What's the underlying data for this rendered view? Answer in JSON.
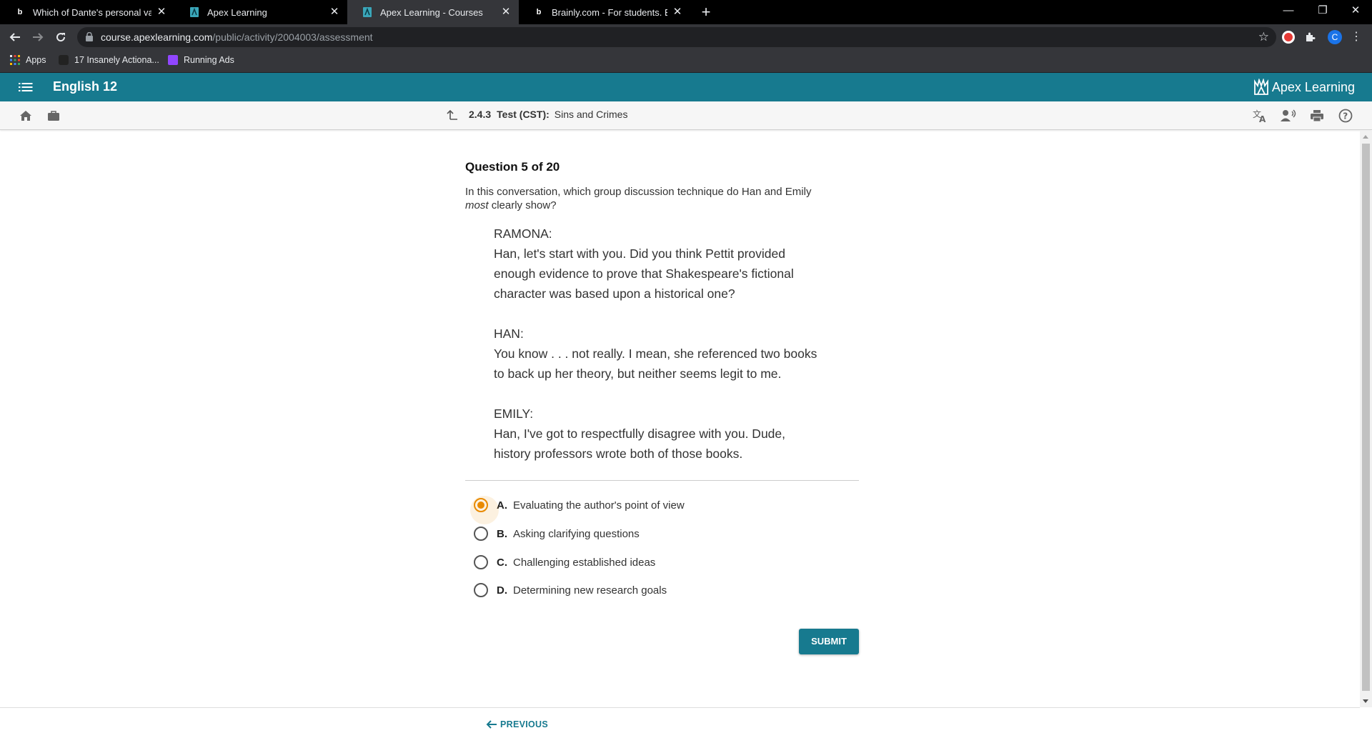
{
  "browser": {
    "tabs": [
      {
        "favicon": "brainly-icon",
        "title": "Which of Dante's personal values",
        "active": false
      },
      {
        "favicon": "apex-icon",
        "title": "Apex Learning",
        "active": false
      },
      {
        "favicon": "apex-icon",
        "title": "Apex Learning - Courses",
        "active": true
      },
      {
        "favicon": "brainly-icon",
        "title": "Brainly.com - For students. By students",
        "active": false
      }
    ],
    "url_host": "course.apexlearning.com",
    "url_path": "/public/activity/2004003/assessment",
    "profile_initial": "C",
    "bookmarks": [
      {
        "icon": "apps-grid-icon",
        "label": "Apps"
      },
      {
        "icon": "bookmark-favicon",
        "label": "17 Insanely Actiona..."
      },
      {
        "icon": "twitch-icon",
        "label": "Running Ads"
      }
    ]
  },
  "app": {
    "course_title": "English 12",
    "logo_text": "Apex Learning",
    "brand_color": "#177a8f",
    "breadcrumb": {
      "number": "2.4.3",
      "type": "Test (CST):",
      "title": "Sins and Crimes"
    }
  },
  "question": {
    "counter": "Question 5 of 20",
    "prompt_pre": "In this conversation, which group discussion technique do Han and Emily",
    "prompt_em": "most",
    "prompt_post": "clearly show?",
    "passage": [
      {
        "speaker": "RAMONA:",
        "lines": [
          "Han, let's start with you. Did you think Pettit provided",
          "enough evidence to prove that Shakespeare's fictional",
          "character was based upon a historical one?"
        ]
      },
      {
        "speaker": "HAN:",
        "lines": [
          "You know . . . not really. I mean, she referenced two books",
          "to back up her theory, but neither seems legit to me."
        ]
      },
      {
        "speaker": "EMILY:",
        "lines": [
          "Han, I've got to respectfully disagree with you. Dude,",
          "history professors wrote both of those books."
        ]
      }
    ],
    "options": [
      {
        "letter": "A.",
        "text": "Evaluating the author's point of view",
        "selected": true
      },
      {
        "letter": "B.",
        "text": "Asking clarifying questions",
        "selected": false
      },
      {
        "letter": "C.",
        "text": "Challenging established ideas",
        "selected": false
      },
      {
        "letter": "D.",
        "text": "Determining new research goals",
        "selected": false
      }
    ],
    "submit_label": "SUBMIT",
    "selected_color": "#e98a00"
  },
  "footer": {
    "previous_label": "PREVIOUS"
  }
}
